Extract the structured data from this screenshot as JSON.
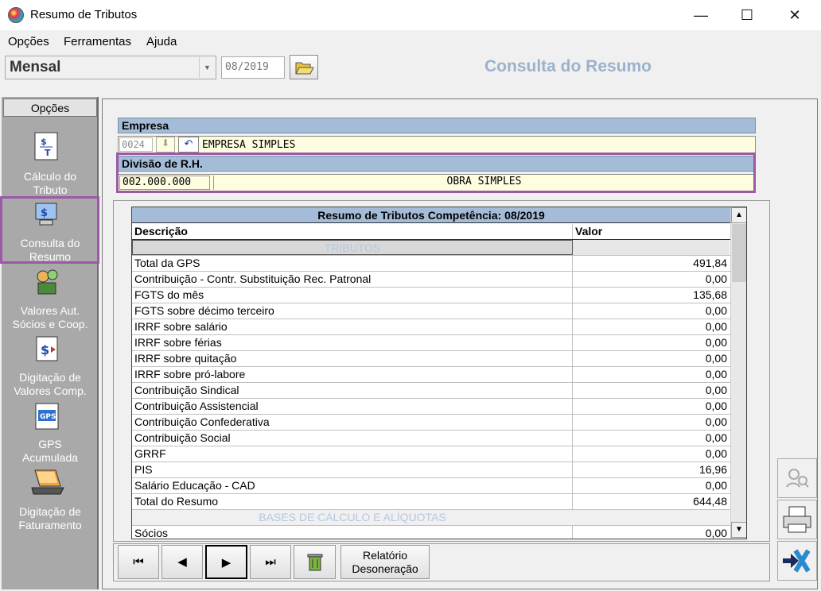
{
  "window": {
    "title": "Resumo de Tributos",
    "minimize": "—",
    "maximize": "☐",
    "close": "✕"
  },
  "menu": [
    "Opções",
    "Ferramentas",
    "Ajuda"
  ],
  "toolbar": {
    "period": "Mensal",
    "date": "08/2019",
    "page_title": "Consulta do Resumo"
  },
  "sidebar": {
    "tab": "Opções",
    "items": [
      {
        "line1": "Cálculo do",
        "line2": "Tributo",
        "icon": "calc-document-icon"
      },
      {
        "line1": "Consulta do",
        "line2": "Resumo",
        "icon": "computer-money-icon"
      },
      {
        "line1": "Valores Aut.",
        "line2": "Sócios e Coop.",
        "icon": "people-money-icon"
      },
      {
        "line1": "Digitação de",
        "line2": "Valores Comp.",
        "icon": "money-form-icon"
      },
      {
        "line1": "GPS",
        "line2": "Acumulada",
        "icon": "gps-icon"
      },
      {
        "line1": "Digitação de",
        "line2": "Faturamento",
        "icon": "laptop-icon"
      }
    ]
  },
  "empresa": {
    "label": "Empresa",
    "code": "0024",
    "name": "EMPRESA SIMPLES"
  },
  "divisao": {
    "label": "Divisão de R.H.",
    "code": "002.000.000",
    "name": "OBRA SIMPLES"
  },
  "grid": {
    "caption": "Resumo de Tributos Competência: 08/2019",
    "col_desc": "Descrição",
    "col_valor": "Valor",
    "section1": "TRIBUTOS",
    "rows": [
      {
        "desc": "Total da GPS",
        "valor": "491,84"
      },
      {
        "desc": "Contribuição - Contr. Substituição Rec. Patronal",
        "valor": "0,00"
      },
      {
        "desc": "FGTS do mês",
        "valor": "135,68"
      },
      {
        "desc": "FGTS sobre décimo terceiro",
        "valor": "0,00"
      },
      {
        "desc": "IRRF sobre salário",
        "valor": "0,00"
      },
      {
        "desc": "IRRF sobre férias",
        "valor": "0,00"
      },
      {
        "desc": "IRRF sobre quitação",
        "valor": "0,00"
      },
      {
        "desc": "IRRF sobre pró-labore",
        "valor": "0,00"
      },
      {
        "desc": "Contribuição Sindical",
        "valor": "0,00"
      },
      {
        "desc": "Contribuição Assistencial",
        "valor": "0,00"
      },
      {
        "desc": "Contribuição Confederativa",
        "valor": "0,00"
      },
      {
        "desc": "Contribuição Social",
        "valor": "0,00"
      },
      {
        "desc": "GRRF",
        "valor": "0,00"
      },
      {
        "desc": "PIS",
        "valor": "16,96"
      },
      {
        "desc": "Salário Educação - CAD",
        "valor": "0,00"
      },
      {
        "desc": "Total do Resumo",
        "valor": "644,48"
      }
    ],
    "section2": "BASES DE CÁLCULO E ALÍQUOTAS",
    "rows2": [
      {
        "desc": "Sócios",
        "valor": "0,00"
      }
    ]
  },
  "nav": {
    "first": "⏮",
    "prev": "◀",
    "next": "▶",
    "last": "⏭",
    "relatorio_line1": "Relatório",
    "relatorio_line2": "Desoneração"
  }
}
